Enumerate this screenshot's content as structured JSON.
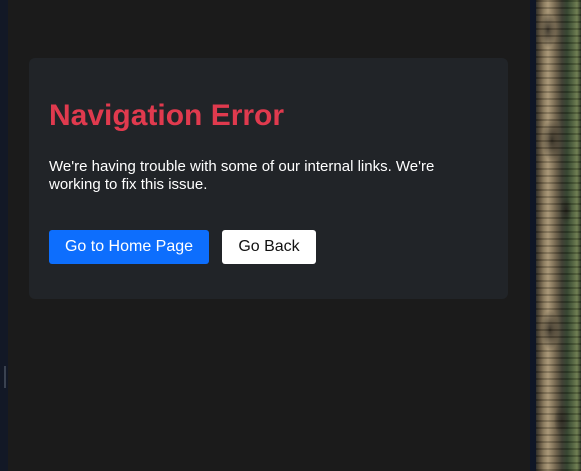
{
  "error": {
    "title": "Navigation Error",
    "message": "We're having trouble with some of our internal links. We're working to fix this issue.",
    "primary_button_label": "Go to Home Page",
    "secondary_button_label": "Go Back"
  },
  "colors": {
    "background": "#1b1b1b",
    "card": "#212428",
    "title": "#e03a4e",
    "primary_button": "#0d6efd",
    "secondary_button": "#ffffff"
  }
}
